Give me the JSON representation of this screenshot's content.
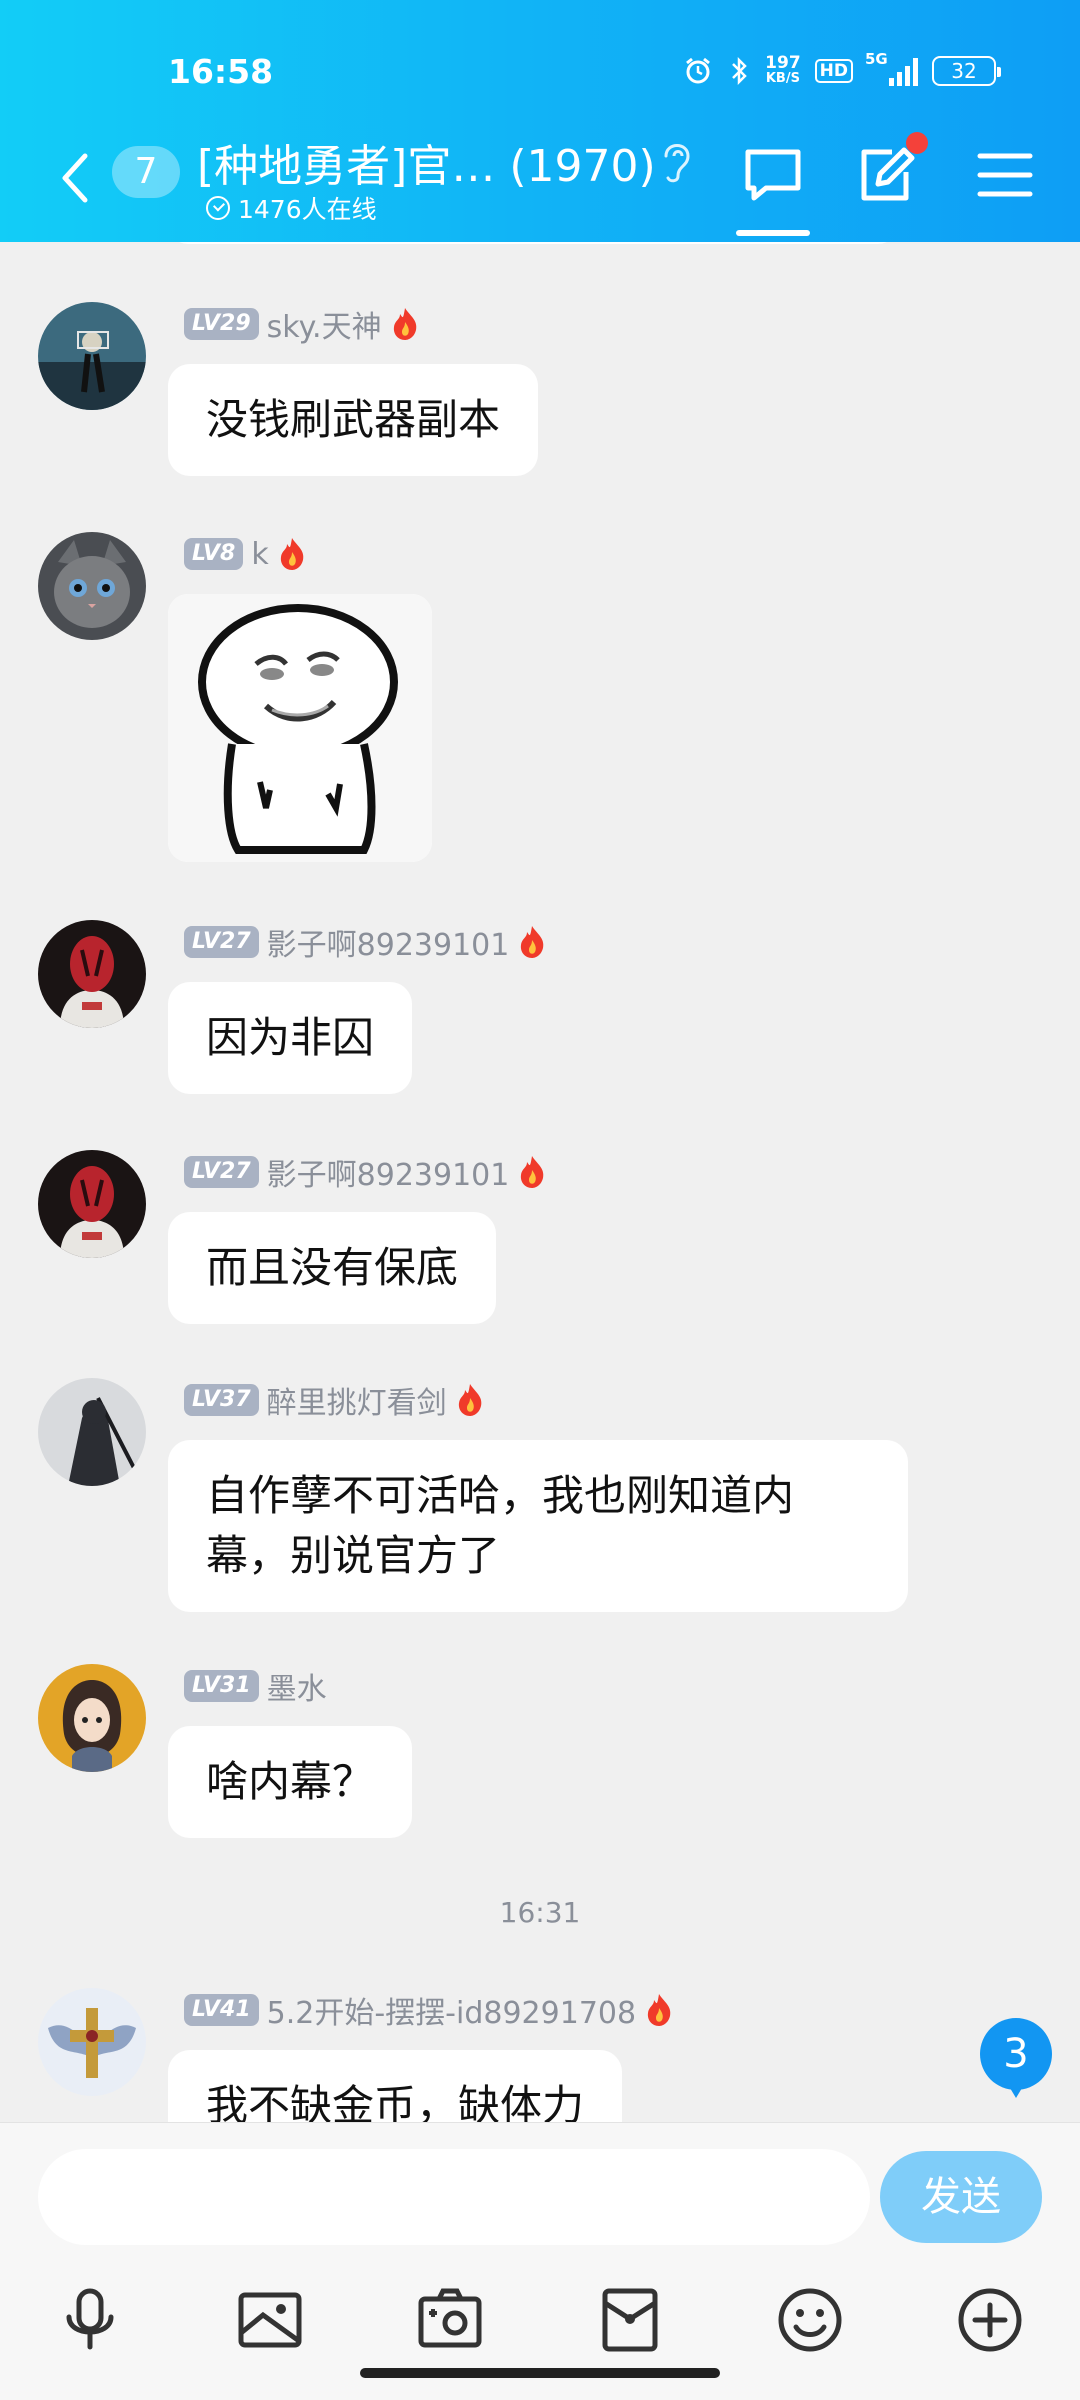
{
  "status_bar": {
    "time": "16:58",
    "net_speed_value": "197",
    "net_speed_unit": "KB/S",
    "hd": "HD",
    "network": "5G",
    "battery": "32"
  },
  "header": {
    "unread_count": "7",
    "title": "[种地勇者]官…  (1970)",
    "online": "1476人在线"
  },
  "messages": [
    {
      "level": "LV29",
      "name": "sky.天神",
      "text": "没钱刷武器副本",
      "avatar_color": "#3c6a7e"
    },
    {
      "level": "LV8",
      "name": "k",
      "text": "",
      "sticker": "panda-face-sticker",
      "avatar_color": "#4a4d52"
    },
    {
      "level": "LV27",
      "name": "影子啊89239101",
      "text": "因为非囚",
      "avatar_color": "#6a1f2a"
    },
    {
      "level": "LV27",
      "name": "影子啊89239101",
      "text": "而且没有保底",
      "avatar_color": "#6a1f2a"
    },
    {
      "level": "LV37",
      "name": "醉里挑灯看剑",
      "text": "自作孽不可活哈，我也刚知道内幕，别说官方了",
      "avatar_color": "#2b2d33"
    },
    {
      "level": "LV31",
      "name": "墨水",
      "text": "啥内幕？",
      "avatar_color": "#d89a1f"
    },
    {
      "level": "LV41",
      "name": "5.2开始-摆摆-id89291708",
      "text": "我不缺金币，缺体力",
      "avatar_color": "#6c7fa6"
    }
  ],
  "time_divider": "16:31",
  "new_message_badge": "3",
  "composer": {
    "placeholder": "",
    "send_label": "发送"
  },
  "colors": {
    "header_gradient_start": "#12cdf7",
    "header_gradient_end": "#0e9ef5",
    "level_badge": "#a9b2c3",
    "send_button": "#7fcdf9",
    "unread_badge": "#1296f2",
    "notification_dot": "#f4413a"
  },
  "icons": {
    "back": "chevron-left-icon",
    "ear": "ear-icon",
    "chat": "chat-bubble-icon",
    "edit": "edit-note-icon",
    "menu": "hamburger-menu-icon",
    "tools": [
      "microphone-icon",
      "image-icon",
      "camera-icon",
      "red-packet-icon",
      "emoji-icon",
      "plus-circle-icon"
    ]
  }
}
